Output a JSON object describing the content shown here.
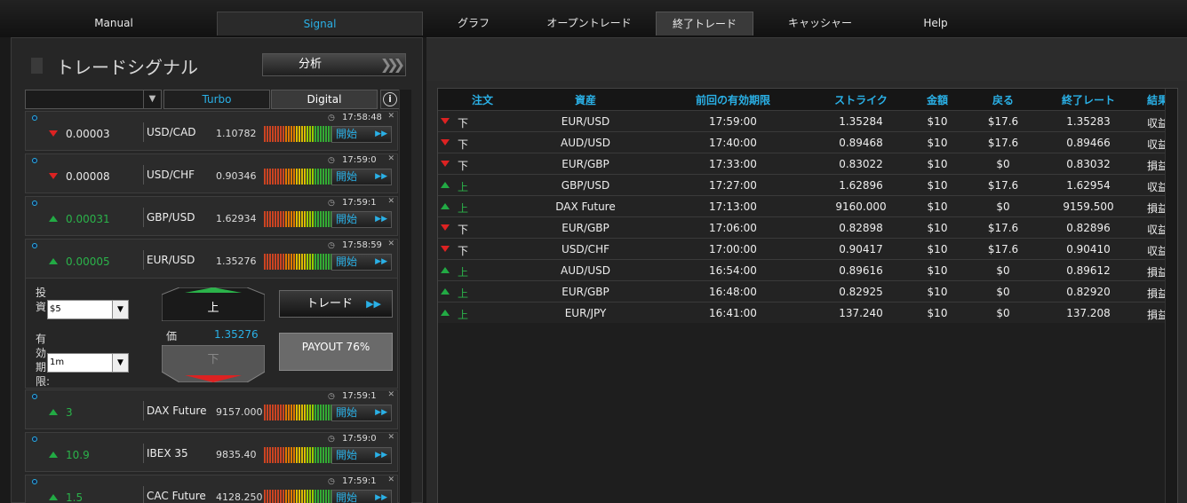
{
  "nav": {
    "tabs": [
      {
        "label": "Manual"
      },
      {
        "label": "Signal"
      },
      {
        "label": "グラフ"
      },
      {
        "label": "オープントレード"
      },
      {
        "label": "終了トレード"
      },
      {
        "label": "キャッシャー"
      },
      {
        "label": "Help"
      }
    ]
  },
  "signals_panel": {
    "title": "トレードシグナル",
    "analysis_button": "分析",
    "filter": {
      "select_value": "",
      "turbo_label": "Turbo",
      "digital_label": "Digital",
      "info_glyph": "i"
    },
    "items": [
      {
        "time": "17:58:48",
        "direction": "down",
        "change": "0.00003",
        "asset": "USD/CAD",
        "price": "1.10782",
        "start_label": "開始"
      },
      {
        "time": "17:59:0",
        "direction": "down",
        "change": "0.00008",
        "asset": "USD/CHF",
        "price": "0.90346",
        "start_label": "開始"
      },
      {
        "time": "17:59:1",
        "direction": "up",
        "change": "0.00031",
        "asset": "GBP/USD",
        "price": "1.62934",
        "start_label": "開始"
      },
      {
        "time": "17:58:59",
        "direction": "up",
        "change": "0.00005",
        "asset": "EUR/USD",
        "price": "1.35276",
        "start_label": "開始"
      },
      {
        "time": "17:59:1",
        "direction": "up",
        "change": "3",
        "asset": "DAX Future",
        "price": "9157.000",
        "start_label": "開始"
      },
      {
        "time": "17:59:0",
        "direction": "up",
        "change": "10.9",
        "asset": "IBEX 35",
        "price": "9835.40",
        "start_label": "開始"
      },
      {
        "time": "17:59:1",
        "direction": "up",
        "change": "1.5",
        "asset": "CAC Future",
        "price": "4128.250",
        "start_label": "開始"
      }
    ],
    "trade": {
      "investment_label": "投資:",
      "investment_value": "$5",
      "expiry_label": "有効期限:",
      "expiry_value": "1m",
      "call_label": "上",
      "put_label": "下",
      "price_label": "価",
      "price_value": "1.35276",
      "trade_button": "トレード",
      "payout": "PAYOUT 76%"
    }
  },
  "closed_trades": {
    "headers": [
      "注文",
      "資産",
      "前回の有効期限",
      "ストライク",
      "金額",
      "戻る",
      "終了レート",
      "結果"
    ],
    "rows": [
      {
        "direction": "down",
        "dir_label": "下",
        "asset": "EUR/USD",
        "expiry": "17:59:00",
        "strike": "1.35284",
        "amount": "$10",
        "return": "$17.6",
        "close_rate": "1.35283",
        "result": "収益"
      },
      {
        "direction": "down",
        "dir_label": "下",
        "asset": "AUD/USD",
        "expiry": "17:40:00",
        "strike": "0.89468",
        "amount": "$10",
        "return": "$17.6",
        "close_rate": "0.89466",
        "result": "収益"
      },
      {
        "direction": "down",
        "dir_label": "下",
        "asset": "EUR/GBP",
        "expiry": "17:33:00",
        "strike": "0.83022",
        "amount": "$10",
        "return": "$0",
        "close_rate": "0.83032",
        "result": "損益"
      },
      {
        "direction": "up",
        "dir_label": "上",
        "asset": "GBP/USD",
        "expiry": "17:27:00",
        "strike": "1.62896",
        "amount": "$10",
        "return": "$17.6",
        "close_rate": "1.62954",
        "result": "収益"
      },
      {
        "direction": "up",
        "dir_label": "上",
        "asset": "DAX Future",
        "expiry": "17:13:00",
        "strike": "9160.000",
        "amount": "$10",
        "return": "$0",
        "close_rate": "9159.500",
        "result": "損益"
      },
      {
        "direction": "down",
        "dir_label": "下",
        "asset": "EUR/GBP",
        "expiry": "17:06:00",
        "strike": "0.82898",
        "amount": "$10",
        "return": "$17.6",
        "close_rate": "0.82896",
        "result": "収益"
      },
      {
        "direction": "down",
        "dir_label": "下",
        "asset": "USD/CHF",
        "expiry": "17:00:00",
        "strike": "0.90417",
        "amount": "$10",
        "return": "$17.6",
        "close_rate": "0.90410",
        "result": "収益"
      },
      {
        "direction": "up",
        "dir_label": "上",
        "asset": "AUD/USD",
        "expiry": "16:54:00",
        "strike": "0.89616",
        "amount": "$10",
        "return": "$0",
        "close_rate": "0.89612",
        "result": "損益"
      },
      {
        "direction": "up",
        "dir_label": "上",
        "asset": "EUR/GBP",
        "expiry": "16:48:00",
        "strike": "0.82925",
        "amount": "$10",
        "return": "$0",
        "close_rate": "0.82920",
        "result": "損益"
      },
      {
        "direction": "up",
        "dir_label": "上",
        "asset": "EUR/JPY",
        "expiry": "16:41:00",
        "strike": "137.240",
        "amount": "$10",
        "return": "$0",
        "close_rate": "137.208",
        "result": "損益"
      }
    ]
  },
  "colors": {
    "accent": "#2ab0e6",
    "up": "#2bb34a",
    "down": "#dd2222"
  }
}
